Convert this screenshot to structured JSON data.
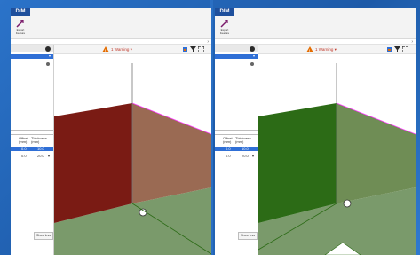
{
  "brand": "DIM",
  "tool_label": "Export Feature",
  "warning_text": "1 Warning ▾",
  "grid": {
    "col1": "Offset (mm)",
    "col2": "Thickness (mm)",
    "rows": [
      [
        "0.0",
        "10.0"
      ],
      [
        "0.0",
        "20.0"
      ]
    ]
  },
  "apply_label": "Show less",
  "colors": {
    "desktop": "#2b73c9",
    "wall_red": "#7a1b14",
    "wall_green": "#2c6b16",
    "floor": "#7a9a6b",
    "edge": "#ff3bff"
  },
  "icons": [
    "export-icon",
    "expand-icon",
    "warning-icon",
    "settings-icon",
    "filter-icon",
    "fit-icon"
  ]
}
